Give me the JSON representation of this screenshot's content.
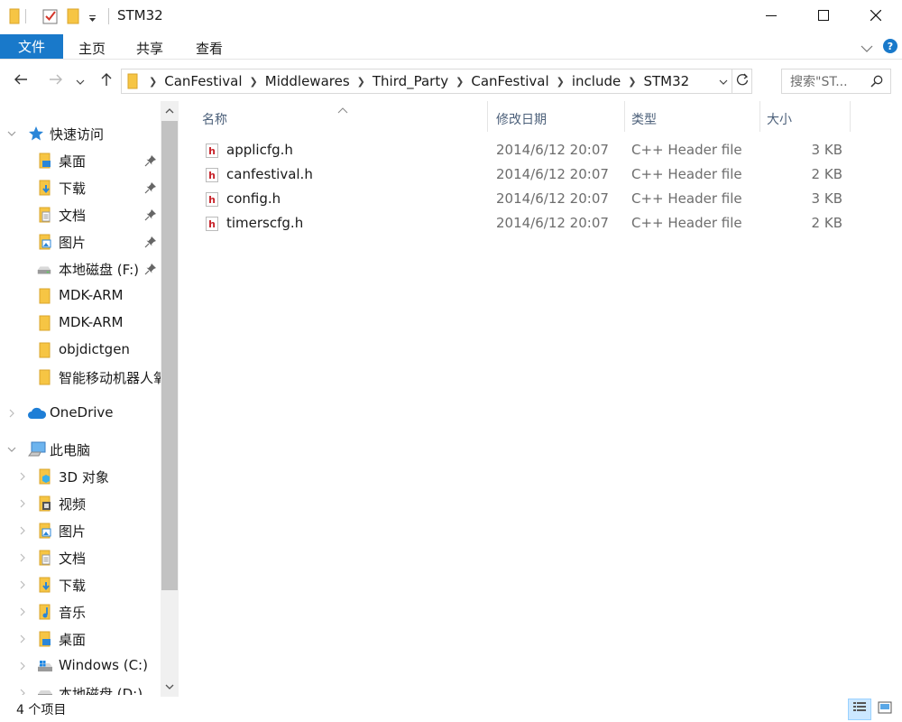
{
  "window": {
    "title": "STM32",
    "quick_access_icons": [
      "folder-icon",
      "properties-check-icon",
      "new-folder-icon",
      "customize-dropdown-icon"
    ],
    "controls": [
      "minimize-icon",
      "maximize-icon",
      "close-icon"
    ]
  },
  "ribbon": {
    "tabs": [
      {
        "label": "文件",
        "active": true
      },
      {
        "label": "主页"
      },
      {
        "label": "共享"
      },
      {
        "label": "查看"
      }
    ],
    "expand_icon": "chevron-down-icon",
    "help_icon": "help-icon"
  },
  "address": {
    "back_icon": "back-arrow-icon",
    "forward_icon": "forward-arrow-icon",
    "recent_icon": "chevron-down-icon",
    "up_icon": "up-arrow-icon",
    "path": [
      "CanFestival",
      "Middlewares",
      "Third_Party",
      "CanFestival",
      "include",
      "STM32"
    ],
    "refresh_icon": "refresh-icon"
  },
  "search": {
    "placeholder": "搜索\"ST..."
  },
  "sidebar": {
    "quick_access": {
      "label": "快速访问",
      "items": [
        {
          "label": "桌面",
          "icon": "desktop-folder-icon",
          "pinned": true
        },
        {
          "label": "下载",
          "icon": "downloads-folder-icon",
          "pinned": true
        },
        {
          "label": "文档",
          "icon": "documents-folder-icon",
          "pinned": true
        },
        {
          "label": "图片",
          "icon": "pictures-folder-icon",
          "pinned": true
        },
        {
          "label": "本地磁盘 (F:)",
          "icon": "drive-icon",
          "pinned": true
        },
        {
          "label": "MDK-ARM",
          "icon": "folder-icon"
        },
        {
          "label": "MDK-ARM",
          "icon": "folder-icon"
        },
        {
          "label": "objdictgen",
          "icon": "folder-icon"
        },
        {
          "label": "智能移动机器人氧",
          "icon": "folder-icon"
        }
      ]
    },
    "onedrive": {
      "label": "OneDrive"
    },
    "this_pc": {
      "label": "此电脑",
      "items": [
        {
          "label": "3D 对象",
          "icon": "3d-objects-folder-icon"
        },
        {
          "label": "视频",
          "icon": "videos-folder-icon"
        },
        {
          "label": "图片",
          "icon": "pictures-folder-icon"
        },
        {
          "label": "文档",
          "icon": "documents-folder-icon"
        },
        {
          "label": "下载",
          "icon": "downloads-folder-icon"
        },
        {
          "label": "音乐",
          "icon": "music-folder-icon"
        },
        {
          "label": "桌面",
          "icon": "desktop-folder-icon"
        },
        {
          "label": "Windows (C:)",
          "icon": "windows-drive-icon"
        },
        {
          "label": "本地磁盘 (D:)",
          "icon": "drive-icon"
        }
      ]
    }
  },
  "file_list": {
    "columns": [
      "名称",
      "修改日期",
      "类型",
      "大小"
    ],
    "sort_column": "名称",
    "rows": [
      {
        "name": "applicfg.h",
        "date": "2014/6/12 20:07",
        "type": "C++ Header file",
        "size": "3 KB"
      },
      {
        "name": "canfestival.h",
        "date": "2014/6/12 20:07",
        "type": "C++ Header file",
        "size": "2 KB"
      },
      {
        "name": "config.h",
        "date": "2014/6/12 20:07",
        "type": "C++ Header file",
        "size": "3 KB"
      },
      {
        "name": "timerscfg.h",
        "date": "2014/6/12 20:07",
        "type": "C++ Header file",
        "size": "2 KB"
      }
    ]
  },
  "status": {
    "count": "4 个项目",
    "views": [
      "details-view-icon",
      "large-icons-view-icon"
    ],
    "active_view": "details-view-icon"
  },
  "colors": {
    "accent": "#1979ca",
    "folder": "#f6c544",
    "header_text": "#4c607a",
    "secondary_text": "#6d6d6d",
    "selection": "#cce8ff"
  }
}
